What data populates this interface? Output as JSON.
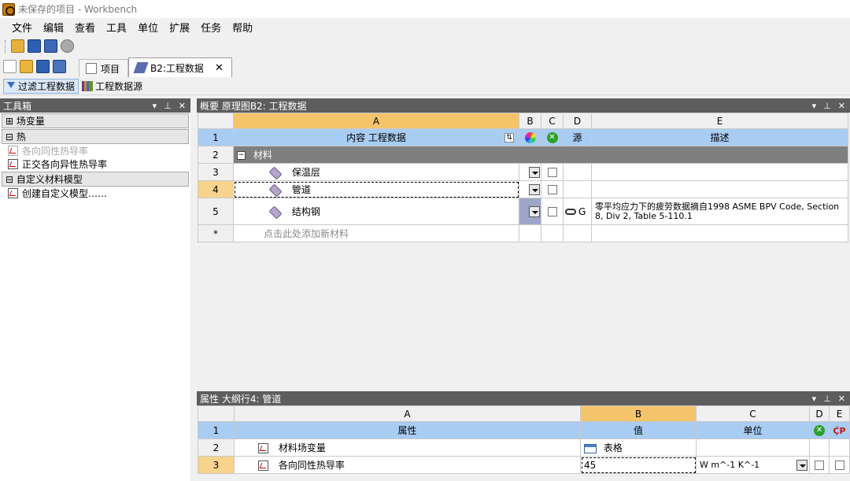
{
  "window": {
    "title": "未保存的项目 - Workbench"
  },
  "menu": [
    "文件",
    "编辑",
    "查看",
    "工具",
    "单位",
    "扩展",
    "任务",
    "帮助"
  ],
  "tabs": [
    {
      "label": "项目",
      "active": false
    },
    {
      "label": "B2:工程数据",
      "active": true,
      "close": "✕"
    }
  ],
  "toolbar3": {
    "filter_label": "过滤工程数据",
    "sources_label": "工程数据源"
  },
  "toolbox": {
    "title": "工具箱",
    "groups": [
      {
        "label": "⊞ 场变量",
        "items": []
      },
      {
        "label": "⊟ 热",
        "items": [
          {
            "label": "各向同性热导率",
            "enabled": false
          },
          {
            "label": "正交各向异性热导率",
            "enabled": true
          }
        ]
      },
      {
        "label": "⊟ 自定义材料模型",
        "items": [
          {
            "label": "创建自定义模型……",
            "enabled": true
          }
        ]
      }
    ]
  },
  "outline": {
    "title": "概要 原理图B2: 工程数据",
    "columns": [
      "A",
      "B",
      "C",
      "D",
      "E"
    ],
    "header_row": {
      "num": "1",
      "content": "内容 工程数据",
      "source": "源",
      "description": "描述"
    },
    "category_row": {
      "num": "2",
      "label": "材料"
    },
    "materials": [
      {
        "num": "3",
        "name": "保温层",
        "source": "",
        "description": "",
        "selected": false
      },
      {
        "num": "4",
        "name": "管道",
        "source": "",
        "description": "",
        "selected": true
      },
      {
        "num": "5",
        "name": "结构钢",
        "source": "G",
        "description": "零平均应力下的疲劳数据摘自1998 ASME BPV Code, Section 8, Div 2, Table 5-110.1",
        "selected": false
      }
    ],
    "add_row": {
      "num": "*",
      "label": "点击此处添加新材料"
    }
  },
  "properties": {
    "title": "属性 大纲行4: 管道",
    "columns": [
      "A",
      "B",
      "C",
      "D",
      "E"
    ],
    "header_row": {
      "num": "1",
      "property": "属性",
      "value": "值",
      "unit": "单位"
    },
    "rows": [
      {
        "num": "2",
        "property": "材料场变量",
        "value": "表格",
        "unit": ""
      },
      {
        "num": "3",
        "property": "各向同性热导率",
        "value": "45",
        "unit": "W m^-1 K^-1"
      }
    ]
  },
  "colors": {
    "header_blue": "#a9cdf2",
    "selected_orange": "#f4c46a",
    "panel_header": "#5d5d5d"
  }
}
